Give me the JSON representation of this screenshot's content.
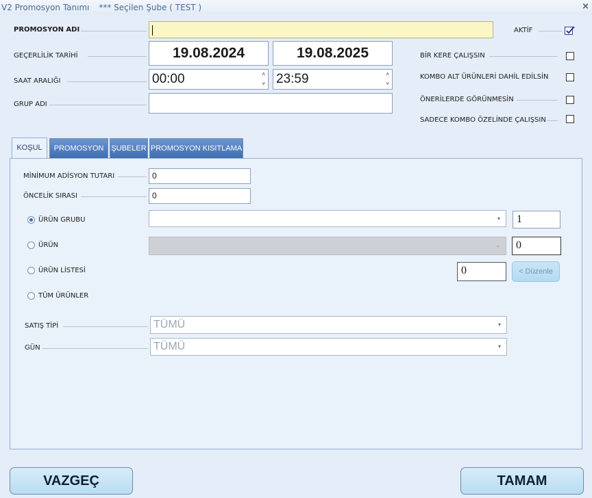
{
  "window": {
    "title": "V2 Promosyon Tanımı",
    "subtitle": "*** Seçilen Şube ( TEST )",
    "close_glyph": "×"
  },
  "header": {
    "promo_name_label": "PROMOSYON ADI",
    "promo_name_value": "",
    "validity_label": "GEÇERLİLİK TARİHİ",
    "date_start": "19.08.2024",
    "date_end": "19.08.2025",
    "time_range_label": "SAAT ARALIĞI",
    "time_start": "00:00",
    "time_end": "23:59",
    "group_label": "GRUP ADI",
    "group_value": ""
  },
  "options": [
    {
      "label": "AKTİF",
      "checked": true
    },
    {
      "label": "BİR KERE ÇALIŞSIN",
      "checked": false
    },
    {
      "label": "KOMBO ALT ÜRÜNLERİ DAHİL EDİLSİN",
      "checked": false
    },
    {
      "label": "ÖNERİLERDE GÖRÜNMESİN",
      "checked": false
    },
    {
      "label": "SADECE KOMBO ÖZELİNDE ÇALIŞSIN",
      "checked": false
    }
  ],
  "tabs": [
    {
      "label": "KOŞUL",
      "active": true
    },
    {
      "label": "PROMOSYON",
      "active": false
    },
    {
      "label": "ŞUBELER",
      "active": false
    },
    {
      "label": "PROMOSYON KISITLAMA",
      "active": false
    }
  ],
  "condition": {
    "min_amount_label": "MİNİMUM ADİSYON TUTARI",
    "min_amount_value": "0",
    "priority_label": "ÖNCELİK SIRASI",
    "priority_value": "0",
    "radio_product_group": "ÜRÜN GRUBU",
    "product_group_qty": "1",
    "radio_product": "ÜRÜN",
    "product_qty": "0",
    "radio_product_list": "ÜRÜN LİSTESİ",
    "product_list_qty": "0",
    "edit_button": "< Düzenle",
    "radio_all_products": "TÜM ÜRÜNLER",
    "selected_radio": "ÜRÜN GRUBU",
    "sale_type_label": "SATIŞ TİPİ",
    "sale_type_value": "TÜMÜ",
    "day_label": "GÜN",
    "day_value": "TÜMÜ"
  },
  "footer": {
    "cancel": "VAZGEÇ",
    "ok": "TAMAM"
  },
  "colors": {
    "background": "#e4edf8",
    "tab_blue": "#3f6db0",
    "highlight_input": "#fbf6c5"
  }
}
